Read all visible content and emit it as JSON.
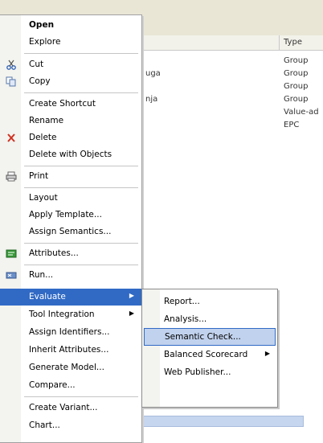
{
  "list": {
    "type_header": "Type",
    "rows": [
      {
        "name": "",
        "type": "Group"
      },
      {
        "name": "uga",
        "type": "Group"
      },
      {
        "name": "",
        "type": "Group"
      },
      {
        "name": "nja",
        "type": "Group"
      },
      {
        "name": "",
        "type": "Value-ad"
      },
      {
        "name": "",
        "type": "EPC"
      }
    ]
  },
  "menu": {
    "items": [
      {
        "label": "Open",
        "icon": "",
        "arrow": ""
      },
      {
        "label": "Explore",
        "icon": "",
        "arrow": ""
      },
      {
        "label": "Cut",
        "icon": "scissors-icon",
        "arrow": ""
      },
      {
        "label": "Copy",
        "icon": "copy-icon",
        "arrow": ""
      },
      {
        "label": "Create Shortcut",
        "icon": "",
        "arrow": ""
      },
      {
        "label": "Rename",
        "icon": "",
        "arrow": ""
      },
      {
        "label": "Delete",
        "icon": "delete-x-icon",
        "arrow": ""
      },
      {
        "label": "Delete with Objects",
        "icon": "",
        "arrow": ""
      },
      {
        "label": "Print",
        "icon": "printer-icon",
        "arrow": ""
      },
      {
        "label": "Layout",
        "icon": "",
        "arrow": ""
      },
      {
        "label": "Apply Template...",
        "icon": "",
        "arrow": ""
      },
      {
        "label": "Assign Semantics...",
        "icon": "",
        "arrow": ""
      },
      {
        "label": "Attributes...",
        "icon": "attributes-icon",
        "arrow": ""
      },
      {
        "label": "Run...",
        "icon": "run-icon",
        "arrow": ""
      },
      {
        "label": "Evaluate",
        "icon": "",
        "arrow": "▶"
      },
      {
        "label": "Tool Integration",
        "icon": "",
        "arrow": "▶"
      },
      {
        "label": "Assign Identifiers...",
        "icon": "",
        "arrow": ""
      },
      {
        "label": "Inherit Attributes...",
        "icon": "",
        "arrow": ""
      },
      {
        "label": "Generate Model...",
        "icon": "",
        "arrow": ""
      },
      {
        "label": "Compare...",
        "icon": "",
        "arrow": ""
      },
      {
        "label": "Create Variant...",
        "icon": "",
        "arrow": ""
      },
      {
        "label": "Chart...",
        "icon": "",
        "arrow": ""
      }
    ]
  },
  "submenu": {
    "items": [
      {
        "label": "Report...",
        "arrow": ""
      },
      {
        "label": "Analysis...",
        "arrow": ""
      },
      {
        "label": "Semantic Check...",
        "arrow": ""
      },
      {
        "label": "Balanced Scorecard",
        "arrow": "▶"
      },
      {
        "label": "Web Publisher...",
        "arrow": ""
      }
    ]
  },
  "colors": {
    "highlight": "#316ac5",
    "submenu_highlight": "#c1d2ee"
  }
}
